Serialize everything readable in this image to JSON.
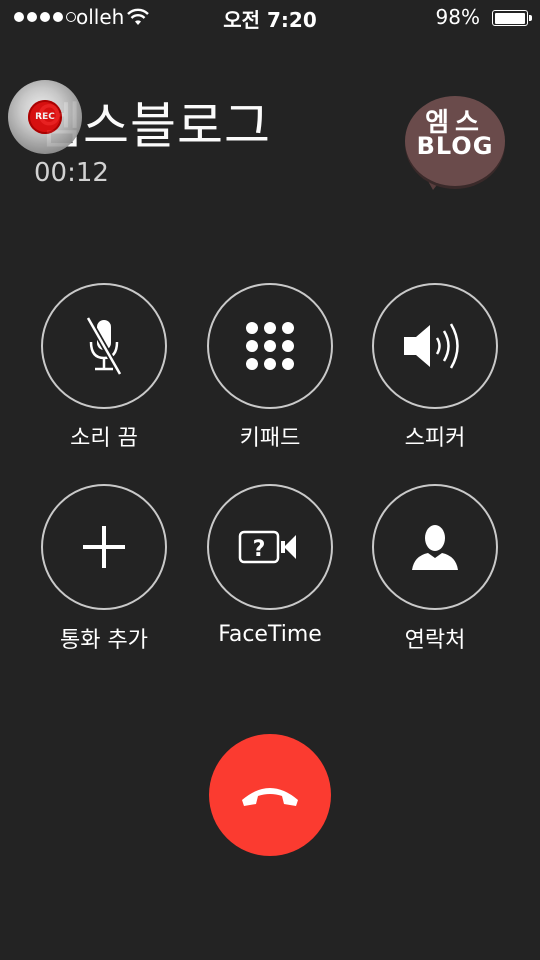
{
  "status_bar": {
    "carrier": "olleh",
    "time": "오전 7:20",
    "battery_percent_text": "98%",
    "battery_level": 0.98,
    "signal_bars_filled": 4,
    "signal_bars_total": 5
  },
  "call": {
    "caller_name": "엠스블로그",
    "duration": "00:12"
  },
  "overlays": {
    "rec_badge_text": "REC",
    "blog_logo_line1": "엠스",
    "blog_logo_line2": "BLOG"
  },
  "controls": {
    "mute": {
      "label": "소리 끔",
      "icon": "mic-muted-icon"
    },
    "keypad": {
      "label": "키패드",
      "icon": "keypad-icon"
    },
    "speaker": {
      "label": "스피커",
      "icon": "speaker-icon"
    },
    "add_call": {
      "label": "통화 추가",
      "icon": "plus-icon"
    },
    "facetime": {
      "label": "FaceTime",
      "icon": "facetime-unknown-icon"
    },
    "contacts": {
      "label": "연락처",
      "icon": "person-icon"
    }
  },
  "end_call": {
    "icon": "hang-up-icon",
    "color": "#fb3b30"
  },
  "colors": {
    "background": "#232323",
    "button_ring": "#c9c9c9"
  }
}
